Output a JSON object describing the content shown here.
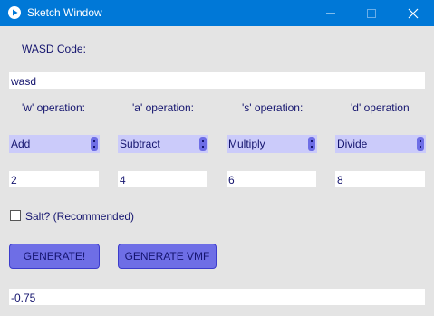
{
  "window": {
    "title": "Sketch Window"
  },
  "wasd": {
    "label": "WASD Code:",
    "value": "wasd"
  },
  "operations": [
    {
      "label": "'w' operation:",
      "selected": "Add",
      "value": "2"
    },
    {
      "label": "'a' operation:",
      "selected": "Subtract",
      "value": "4"
    },
    {
      "label": "'s' operation:",
      "selected": "Multiply",
      "value": "6"
    },
    {
      "label": "'d' operation",
      "selected": "Divide",
      "value": "8"
    }
  ],
  "salt": {
    "label": "Salt? (Recommended)",
    "checked": false
  },
  "buttons": {
    "generate": "GENERATE!",
    "generate_vmf": "GENERATE VMF"
  },
  "output": {
    "value": "-0.75"
  },
  "colors": {
    "titlebar": "#0078d7",
    "background": "#e4e4e4",
    "text": "#14146e",
    "dropdown": "#cbcbfa",
    "button": "#6e6ee6"
  },
  "icons": [
    "app-play-icon",
    "minimize-icon",
    "maximize-icon",
    "close-icon",
    "dropdown-arrow-icon"
  ]
}
